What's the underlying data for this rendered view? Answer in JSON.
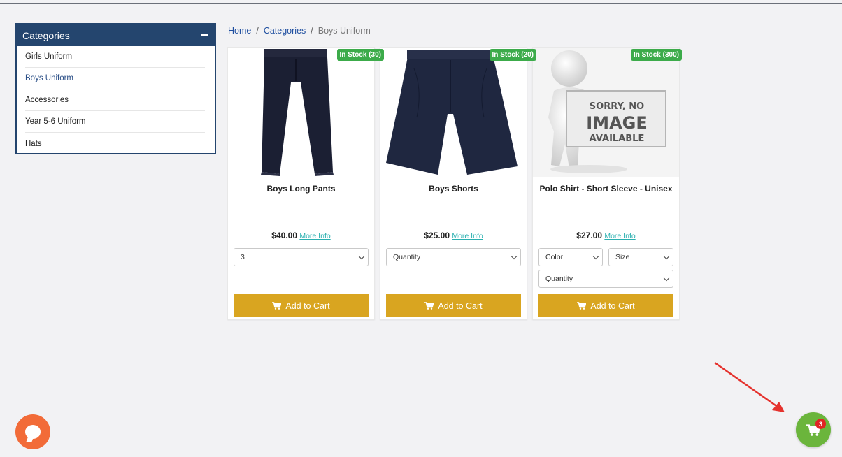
{
  "sidebar": {
    "title": "Categories",
    "items": [
      {
        "label": "Girls Uniform",
        "active": false
      },
      {
        "label": "Boys Uniform",
        "active": true
      },
      {
        "label": "Accessories",
        "active": false
      },
      {
        "label": "Year 5-6 Uniform",
        "active": false
      },
      {
        "label": "Hats",
        "active": false
      }
    ]
  },
  "breadcrumb": {
    "home": "Home",
    "categories": "Categories",
    "current": "Boys Uniform",
    "separator": "/"
  },
  "products": [
    {
      "title": "Boys Long Pants",
      "stock": "In Stock (30)",
      "price": "$40.00",
      "more_info": "More Info",
      "selects": [
        "3"
      ],
      "add_to_cart": "Add to Cart"
    },
    {
      "title": "Boys Shorts",
      "stock": "In Stock (20)",
      "price": "$25.00",
      "more_info": "More Info",
      "selects": [
        "Quantity"
      ],
      "add_to_cart": "Add to Cart"
    },
    {
      "title": "Polo Shirt - Short Sleeve - Unisex",
      "stock": "In Stock (300)",
      "price": "$27.00",
      "more_info": "More Info",
      "selects": [
        "Color",
        "Size",
        "Quantity"
      ],
      "add_to_cart": "Add to Cart",
      "placeholder_image": {
        "line1": "SORRY, NO",
        "line2": "IMAGE",
        "line3": "AVAILABLE"
      }
    }
  ],
  "cart": {
    "count": "3",
    "color": "#6bb53c",
    "badge_color": "#e02424"
  },
  "colors": {
    "primary": "#24456e",
    "accent_button": "#d9a520",
    "stock_badge": "#3cab4a",
    "chat": "#f26b38",
    "annotation_arrow": "#e5322d"
  }
}
